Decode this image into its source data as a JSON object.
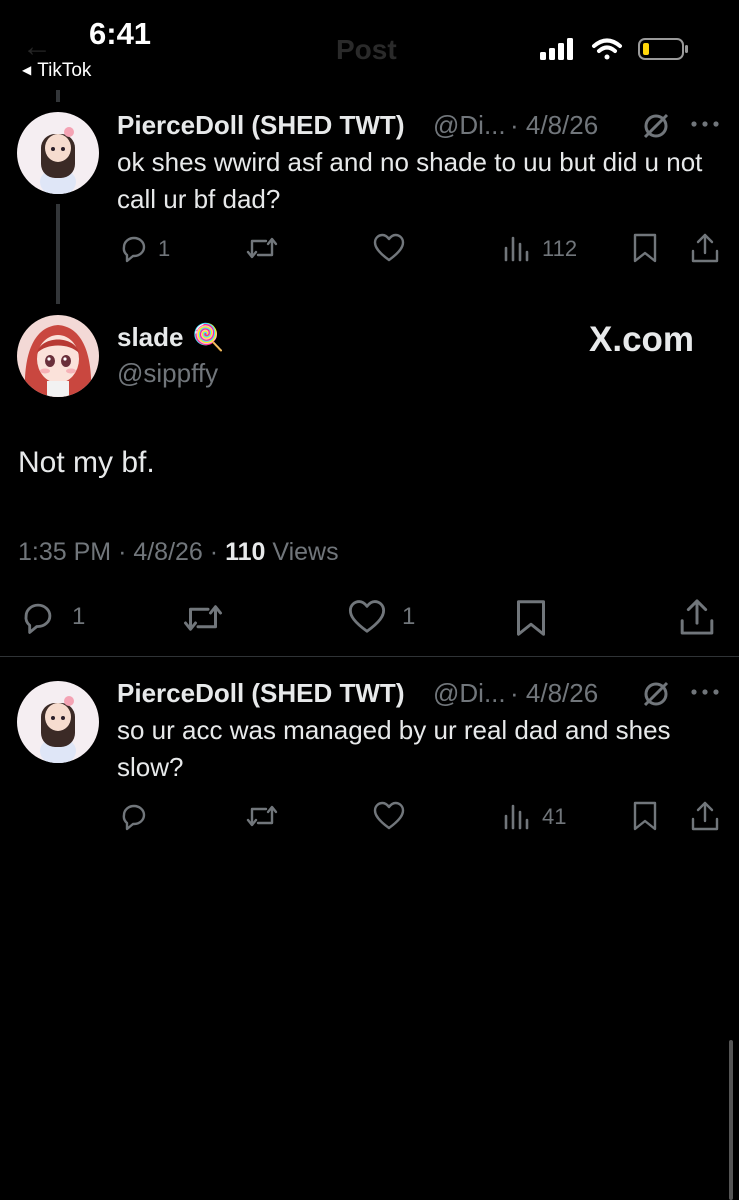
{
  "status_bar": {
    "time": "6:41",
    "back_app": "TikTok",
    "page_title": "Post"
  },
  "watermark": "X.com",
  "reply_top": {
    "display_name": "PierceDoll (SHED TWT)",
    "handle": "@Di...",
    "date": "· 4/8/26",
    "text": "ok shes wwird asf and no shade to uu but did u not call ur bf dad?",
    "replies": "1",
    "views": "112"
  },
  "main_post": {
    "display_name": "slade",
    "emoji": "🍭",
    "handle": "@sippffy",
    "text": "Not my bf.",
    "time": "1:35 PM",
    "date": "· 4/8/26 ·",
    "views_count": "110",
    "views_label": "Views",
    "replies": "1",
    "likes": "1"
  },
  "reply_bottom": {
    "display_name": "PierceDoll (SHED TWT)",
    "handle": "@Di...",
    "date": "· 4/8/26",
    "text": "so ur acc was managed by ur real dad and shes slow?",
    "views": "41"
  },
  "colors": {
    "background": "#000000",
    "text": "#e7e9ea",
    "secondary": "#71767b",
    "divider": "#2f3336"
  }
}
